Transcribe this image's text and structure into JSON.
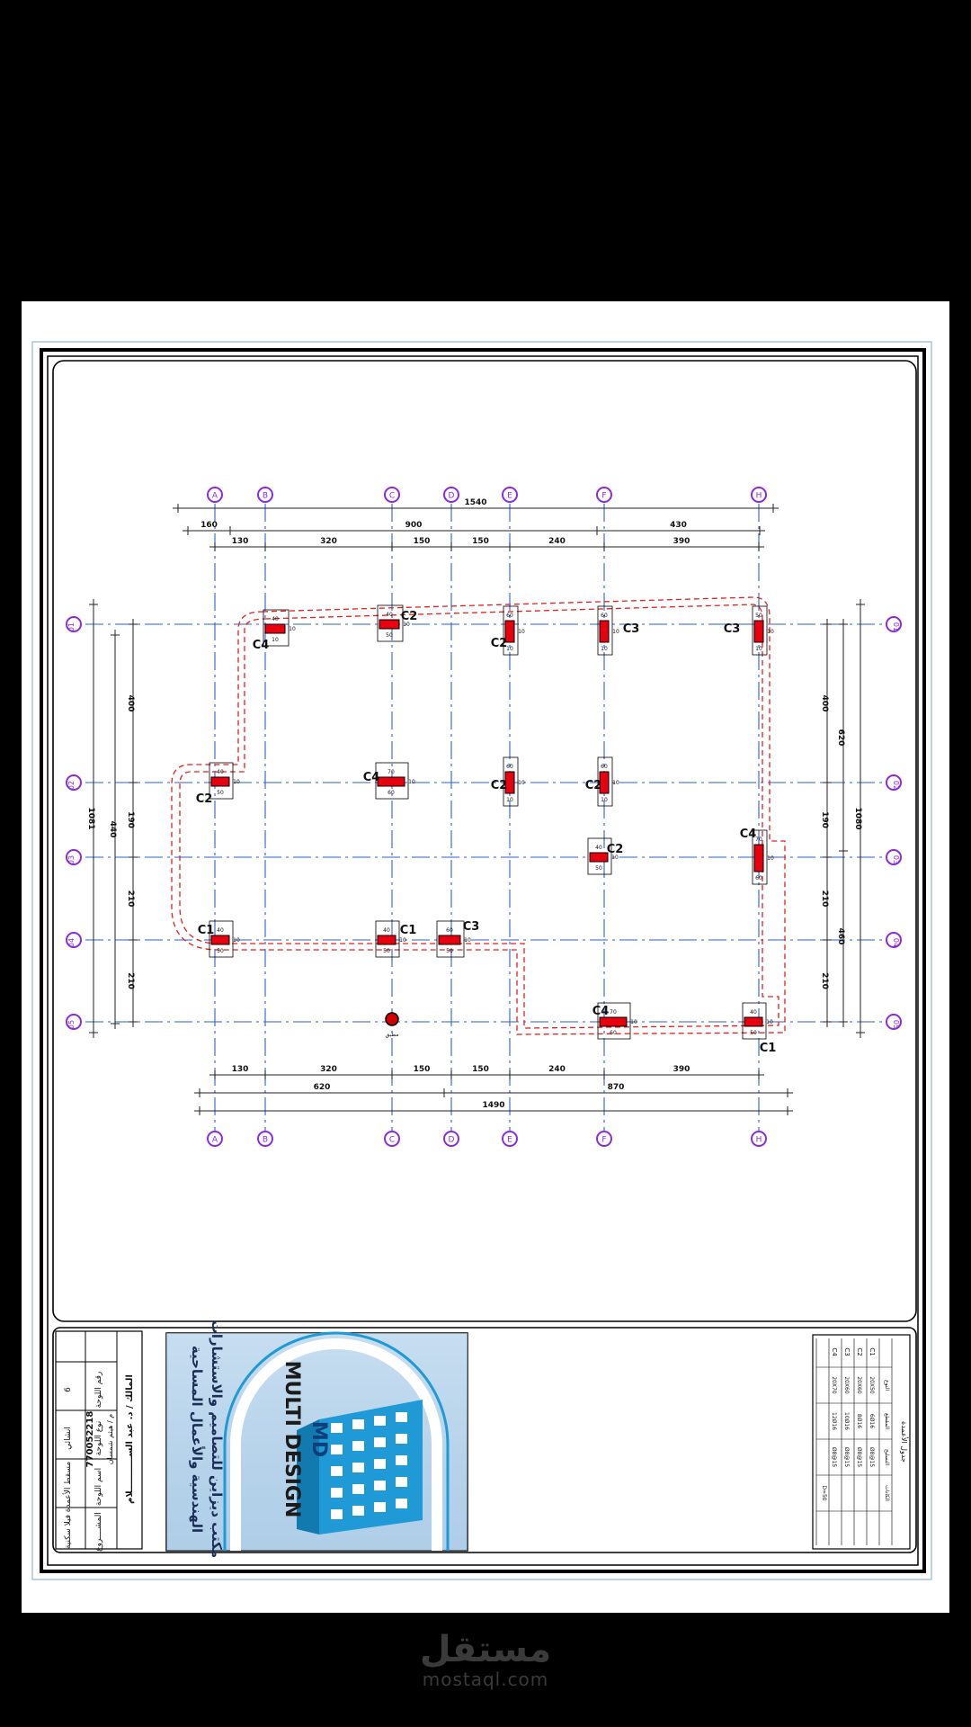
{
  "plan": {
    "grid_x": [
      {
        "id": "A",
        "label": "A"
      },
      {
        "id": "B",
        "label": "B"
      },
      {
        "id": "C",
        "label": "C"
      },
      {
        "id": "D",
        "label": "D"
      },
      {
        "id": "E",
        "label": "E"
      },
      {
        "id": "F",
        "label": "F"
      },
      {
        "id": "H",
        "label": "H"
      }
    ],
    "grid_y": [
      {
        "id": "01",
        "label": "01"
      },
      {
        "id": "02",
        "label": "02"
      },
      {
        "id": "03",
        "label": "03"
      },
      {
        "id": "04",
        "label": "04"
      },
      {
        "id": "05",
        "label": "05"
      }
    ],
    "dims_top": {
      "overall": "1540",
      "segments": [
        "160",
        "900",
        "430"
      ],
      "spans": [
        "130",
        "320",
        "150",
        "150",
        "240",
        "390"
      ]
    },
    "dims_bottom": {
      "spans": [
        "130",
        "320",
        "150",
        "150",
        "240",
        "390"
      ],
      "segments": [
        "620",
        "870"
      ],
      "overall": "1490"
    },
    "dims_left": {
      "overall": "1081",
      "segments": [
        "440"
      ],
      "spans": [
        "400",
        "190",
        "210",
        "210"
      ]
    },
    "dims_right": {
      "overall": "1080",
      "segments": [
        "620",
        "460"
      ],
      "spans": [
        "400",
        "190",
        "210",
        "210"
      ]
    },
    "columns": [
      {
        "label": "C4",
        "x": "B",
        "y": "01",
        "dims": [
          "40",
          "10",
          "10"
        ]
      },
      {
        "label": "C2",
        "x": "C",
        "y": "01",
        "dims": [
          "40",
          "50",
          "10"
        ]
      },
      {
        "label": "C2",
        "x": "E",
        "y": "01",
        "dims": [
          "60",
          "10",
          "10"
        ]
      },
      {
        "label": "C3",
        "x": "F",
        "y": "01",
        "dims": [
          "60",
          "10",
          "10"
        ]
      },
      {
        "label": "C3",
        "x": "H",
        "y": "01",
        "dims": [
          "50",
          "10",
          "10"
        ]
      },
      {
        "label": "C2",
        "x": "A",
        "y": "02",
        "dims": [
          "40",
          "50",
          "10"
        ]
      },
      {
        "label": "C4",
        "x": "C",
        "y": "02",
        "dims": [
          "70",
          "60",
          "10"
        ]
      },
      {
        "label": "C2",
        "x": "E",
        "y": "02",
        "dims": [
          "60",
          "10",
          "10"
        ]
      },
      {
        "label": "C2",
        "x": "F",
        "y": "02",
        "dims": [
          "60",
          "10",
          "10"
        ]
      },
      {
        "label": "C2",
        "x": "F",
        "y": "03",
        "dims": [
          "40",
          "50",
          "10"
        ]
      },
      {
        "label": "C4",
        "x": "H",
        "y": "03",
        "dims": [
          "70",
          "60",
          "10"
        ]
      },
      {
        "label": "C1",
        "x": "A",
        "y": "04",
        "dims": [
          "40",
          "50",
          "10"
        ]
      },
      {
        "label": "C1",
        "x": "C",
        "y": "04",
        "dims": [
          "40",
          "50",
          "10"
        ]
      },
      {
        "label": "C3",
        "x": "D",
        "y": "04",
        "dims": [
          "60",
          "50",
          "10"
        ]
      },
      {
        "label": "C4",
        "x": "F",
        "y": "05",
        "dims": [
          "70",
          "60",
          "10"
        ]
      },
      {
        "label": "C1",
        "x": "H",
        "y": "05",
        "dims": [
          "40",
          "50",
          "10"
        ]
      }
    ],
    "manhole_label": "مطبق"
  },
  "title_block": {
    "info_rows": [
      {
        "label": "المشــــروع",
        "value": "فيلا سكنية"
      },
      {
        "label": "اسم اللوحة",
        "value": "مسقط الأعمدة"
      },
      {
        "label": "نوع اللوحة",
        "value": "انشائي"
      },
      {
        "label": "رقم اللوحة",
        "value": "6"
      }
    ],
    "owner": "المالك / د. عبد الســـــــــــلام",
    "engineer": "م / هيثم شمسان",
    "phone": "770052218",
    "logo": {
      "brand": "MULTI DESIGN",
      "monogram": "MD",
      "caption1": "مكتب ديزاين للتصاميم والاستشارات",
      "caption2": "الهندسية والأعمال المساحية"
    },
    "schedule": {
      "title": "جدول الأعمدة",
      "header": [
        "النوع",
        "المقطع",
        "التسليح",
        "الكانات"
      ],
      "rows": [
        {
          "type": "C1",
          "section": "20X50",
          "rebar": "6Ø16",
          "ties": "Ø8@15"
        },
        {
          "type": "C2",
          "section": "20X60",
          "rebar": "8Ø16",
          "ties": "Ø8@15"
        },
        {
          "type": "C3",
          "section": "20X60",
          "rebar": "10Ø16",
          "ties": "Ø8@15"
        },
        {
          "type": "C4",
          "section": "20X70",
          "rebar": "12Ø16",
          "ties": "Ø8@15"
        }
      ],
      "footing_note": "D=50"
    }
  },
  "colors": {
    "grid_line": "#2f5fcf",
    "grid_bubble": "#8a2be2",
    "column_fill": "#e8000e",
    "offset_line": "#e02020",
    "dim_line": "#222222",
    "logo_sky": "#b8d4ec",
    "logo_building": "#1f9ad6"
  },
  "watermark": {
    "arabic": "مستقل",
    "latin": "mostaql.com"
  }
}
